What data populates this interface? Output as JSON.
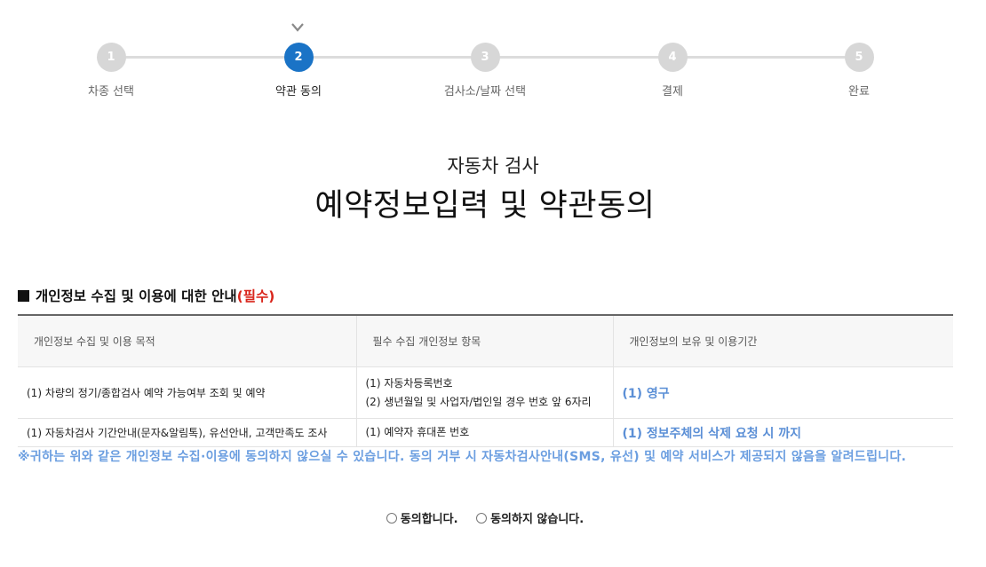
{
  "stepper": {
    "steps": [
      {
        "number": "1",
        "label": "차종 선택"
      },
      {
        "number": "2",
        "label": "약관 동의"
      },
      {
        "number": "3",
        "label": "검사소/날짜 선택"
      },
      {
        "number": "4",
        "label": "결제"
      },
      {
        "number": "5",
        "label": "완료"
      }
    ],
    "active_step": 2
  },
  "page": {
    "sub_title": "자동차 검사",
    "title": "예약정보입력 및 약관동의"
  },
  "section": {
    "heading": "개인정보 수집 및 이용에 대한 안내",
    "required_mark": "(필수)"
  },
  "table": {
    "headers": [
      "개인정보 수집 및 이용 목적",
      "필수 수집 개인정보 항목",
      "개인정보의 보유 및 이용기간"
    ],
    "rows": [
      {
        "purpose": "(1) 차량의 정기/종합검사 예약 가능여부 조회 및 예약",
        "items": [
          "(1) 자동차등록번호",
          "(2) 생년월일 및 사업자/법인일 경우 번호 앞 6자리"
        ],
        "period": "(1) 영구"
      },
      {
        "purpose": "(1) 자동차검사 기간안내(문자&알림톡), 유선안내, 고객만족도 조사",
        "items": [
          "(1) 예약자 휴대폰 번호"
        ],
        "period": "(1) 정보주체의 삭제 요청 시 까지"
      }
    ]
  },
  "notice": "※귀하는 위와 같은 개인정보 수집·이용에 동의하지 않으실 수 있습니다. 동의 거부 시 자동차검사안내(SMS, 유선) 및 예약 서비스가 제공되지 않음을 알려드립니다.",
  "consent": {
    "agree_label": "동의합니다.",
    "disagree_label": "동의하지 않습니다."
  },
  "colors": {
    "accent": "#1a73c6",
    "highlight": "#5b8fd6",
    "required": "#d9261c"
  }
}
